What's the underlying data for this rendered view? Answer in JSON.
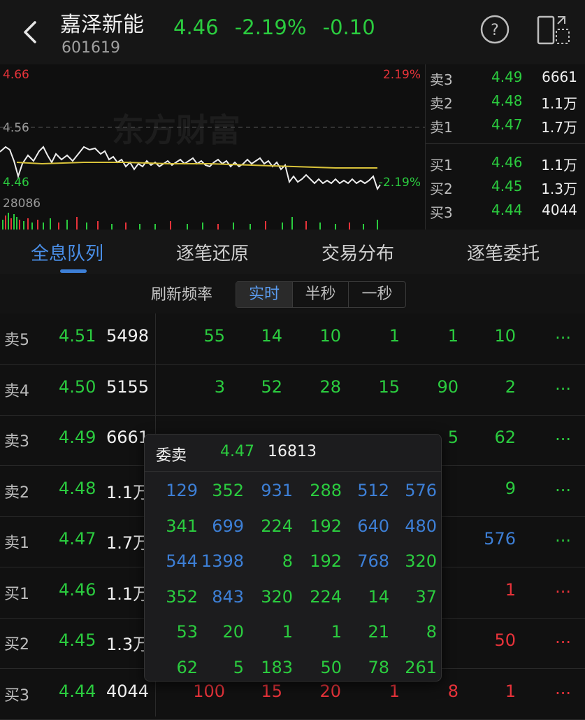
{
  "header": {
    "stock_name": "嘉泽新能",
    "stock_code": "601619",
    "price": "4.46",
    "change_pct": "-2.19%",
    "change_abs": "-0.10"
  },
  "chart": {
    "watermark": "东方财富",
    "high_price": "4.66",
    "high_pct": "2.19%",
    "mid_price": "4.56",
    "low_price": "4.46",
    "low_pct": "-2.19%",
    "volume_max": "28086"
  },
  "orderbook": {
    "rows": [
      {
        "label": "卖3",
        "price": "4.49",
        "vol": "6661"
      },
      {
        "label": "卖2",
        "price": "4.48",
        "vol": "1.1万"
      },
      {
        "label": "卖1",
        "price": "4.47",
        "vol": "1.7万"
      },
      {
        "label": "买1",
        "price": "4.46",
        "vol": "1.1万"
      },
      {
        "label": "买2",
        "price": "4.45",
        "vol": "1.3万"
      },
      {
        "label": "买3",
        "price": "4.44",
        "vol": "4044"
      }
    ]
  },
  "tabs": [
    {
      "label": "全息队列",
      "active": true
    },
    {
      "label": "逐笔还原",
      "active": false
    },
    {
      "label": "交易分布",
      "active": false
    },
    {
      "label": "逐笔委托",
      "active": false
    }
  ],
  "refresh": {
    "label": "刷新频率",
    "options": [
      "实时",
      "半秒",
      "一秒"
    ],
    "selected": "实时"
  },
  "queue": {
    "rows": [
      {
        "label": "卖5",
        "price": "4.51",
        "vol": "5498",
        "cells": [
          "55",
          "14",
          "10",
          "1",
          "1",
          "10"
        ],
        "cell_color": "green",
        "more": "...",
        "more_color": "green"
      },
      {
        "label": "卖4",
        "price": "4.50",
        "vol": "5155",
        "cells": [
          "3",
          "52",
          "28",
          "15",
          "90",
          "2"
        ],
        "cell_color": "green",
        "more": "...",
        "more_color": "green"
      },
      {
        "label": "卖3",
        "price": "4.49",
        "vol": "6661",
        "cells": [
          "",
          "",
          "",
          "",
          "5",
          "62"
        ],
        "cell_color": "green",
        "more": "...",
        "more_color": "green"
      },
      {
        "label": "卖2",
        "price": "4.48",
        "vol": "1.1万",
        "cells": [
          "",
          "",
          "",
          "",
          "",
          "9"
        ],
        "cell_color": "green",
        "more": "...",
        "more_color": "green"
      },
      {
        "label": "卖1",
        "price": "4.47",
        "vol": "1.7万",
        "cells": [
          "",
          "",
          "",
          "",
          "",
          "576"
        ],
        "cell_color": "blue",
        "more": "...",
        "more_color": "green"
      },
      {
        "label": "买1",
        "price": "4.46",
        "vol": "1.1万",
        "cells": [
          "",
          "",
          "",
          "",
          "",
          "1"
        ],
        "cell_color": "red",
        "more": "...",
        "more_color": "red"
      },
      {
        "label": "买2",
        "price": "4.45",
        "vol": "1.3万",
        "cells": [
          "",
          "",
          "",
          "",
          "",
          "50"
        ],
        "cell_color": "red",
        "more": "...",
        "more_color": "red"
      },
      {
        "label": "买3",
        "price": "4.44",
        "vol": "4044",
        "cells": [
          "100",
          "15",
          "20",
          "1",
          "8",
          "1"
        ],
        "cell_color": "red",
        "more": "...",
        "more_color": "red"
      }
    ]
  },
  "popup": {
    "title": "委卖",
    "price": "4.47",
    "volume": "16813",
    "grid": [
      [
        {
          "v": "129",
          "c": "blue"
        },
        {
          "v": "352",
          "c": "green"
        },
        {
          "v": "931",
          "c": "blue"
        },
        {
          "v": "288",
          "c": "green"
        },
        {
          "v": "512",
          "c": "blue"
        },
        {
          "v": "576",
          "c": "blue"
        }
      ],
      [
        {
          "v": "341",
          "c": "green"
        },
        {
          "v": "699",
          "c": "blue"
        },
        {
          "v": "224",
          "c": "green"
        },
        {
          "v": "192",
          "c": "green"
        },
        {
          "v": "640",
          "c": "blue"
        },
        {
          "v": "480",
          "c": "blue"
        }
      ],
      [
        {
          "v": "544",
          "c": "blue"
        },
        {
          "v": "1398",
          "c": "blue"
        },
        {
          "v": "8",
          "c": "green"
        },
        {
          "v": "192",
          "c": "green"
        },
        {
          "v": "768",
          "c": "blue"
        },
        {
          "v": "320",
          "c": "green"
        }
      ],
      [
        {
          "v": "352",
          "c": "green"
        },
        {
          "v": "843",
          "c": "blue"
        },
        {
          "v": "320",
          "c": "green"
        },
        {
          "v": "224",
          "c": "green"
        },
        {
          "v": "14",
          "c": "green"
        },
        {
          "v": "37",
          "c": "green"
        }
      ],
      [
        {
          "v": "53",
          "c": "green"
        },
        {
          "v": "20",
          "c": "green"
        },
        {
          "v": "1",
          "c": "green"
        },
        {
          "v": "1",
          "c": "green"
        },
        {
          "v": "21",
          "c": "green"
        },
        {
          "v": "8",
          "c": "green"
        }
      ],
      [
        {
          "v": "62",
          "c": "green"
        },
        {
          "v": "5",
          "c": "green"
        },
        {
          "v": "183",
          "c": "green"
        },
        {
          "v": "50",
          "c": "green"
        },
        {
          "v": "78",
          "c": "green"
        },
        {
          "v": "261",
          "c": "green"
        }
      ]
    ]
  },
  "colors": {
    "up": "#e8333a",
    "down": "#2bcc3f",
    "accent": "#3d7fd6",
    "avg_line": "#d8c23a"
  }
}
